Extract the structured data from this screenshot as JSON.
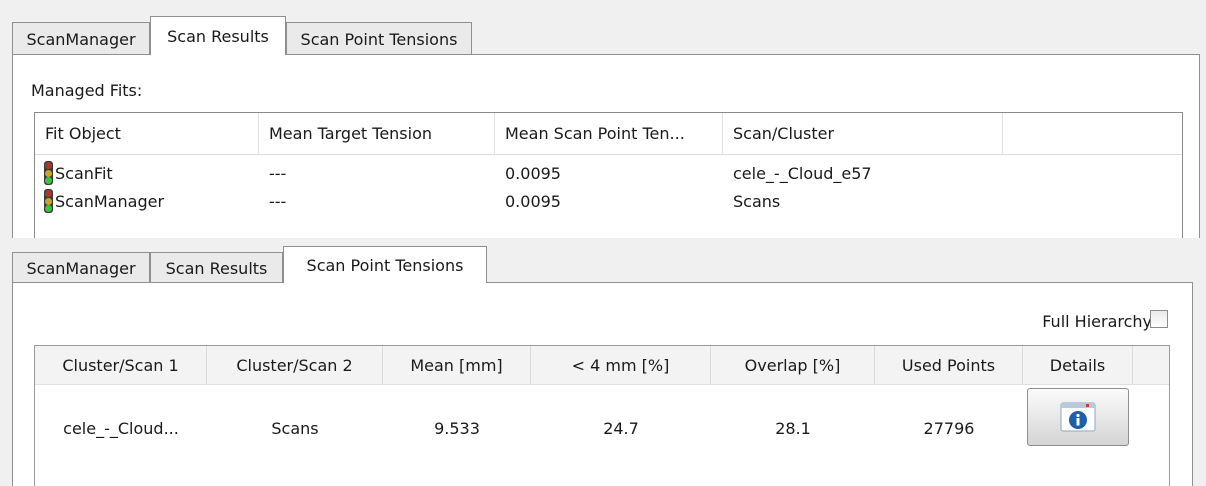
{
  "top_panel": {
    "tabs": [
      {
        "label": "ScanManager",
        "active": false
      },
      {
        "label": "Scan Results",
        "active": true
      },
      {
        "label": "Scan Point Tensions",
        "active": false
      }
    ],
    "managed_fits_label": "Managed Fits:",
    "columns": [
      "Fit Object",
      "Mean Target Tension",
      "Mean Scan Point Ten...",
      "Scan/Cluster"
    ],
    "rows": [
      {
        "icon": "traffic-light-green-icon",
        "fit_object": "ScanFit",
        "mean_target_tension": "---",
        "mean_scan_point_tension": "0.0095",
        "scan_cluster": "cele_-_Cloud_e57"
      },
      {
        "icon": "traffic-light-green-icon",
        "fit_object": "ScanManager",
        "mean_target_tension": "---",
        "mean_scan_point_tension": "0.0095",
        "scan_cluster": "Scans"
      }
    ]
  },
  "bottom_panel": {
    "tabs": [
      {
        "label": "ScanManager",
        "active": false
      },
      {
        "label": "Scan Results",
        "active": false
      },
      {
        "label": "Scan Point Tensions",
        "active": true
      }
    ],
    "full_hierarchy_label": "Full Hierarchy",
    "full_hierarchy_checked": false,
    "columns": [
      "Cluster/Scan 1",
      "Cluster/Scan 2",
      "Mean [mm]",
      "< 4 mm [%]",
      "Overlap [%]",
      "Used Points",
      "Details"
    ],
    "rows": [
      {
        "cluster_scan_1": "cele_-_Cloud...",
        "cluster_scan_2": "Scans",
        "mean": "9.533",
        "under_4mm": "24.7",
        "overlap": "28.1",
        "used_points": "27796",
        "details_icon": "info-icon"
      }
    ]
  },
  "colors": {
    "info_blue": "#1d5fa8",
    "traffic_green": "#35c83c"
  }
}
